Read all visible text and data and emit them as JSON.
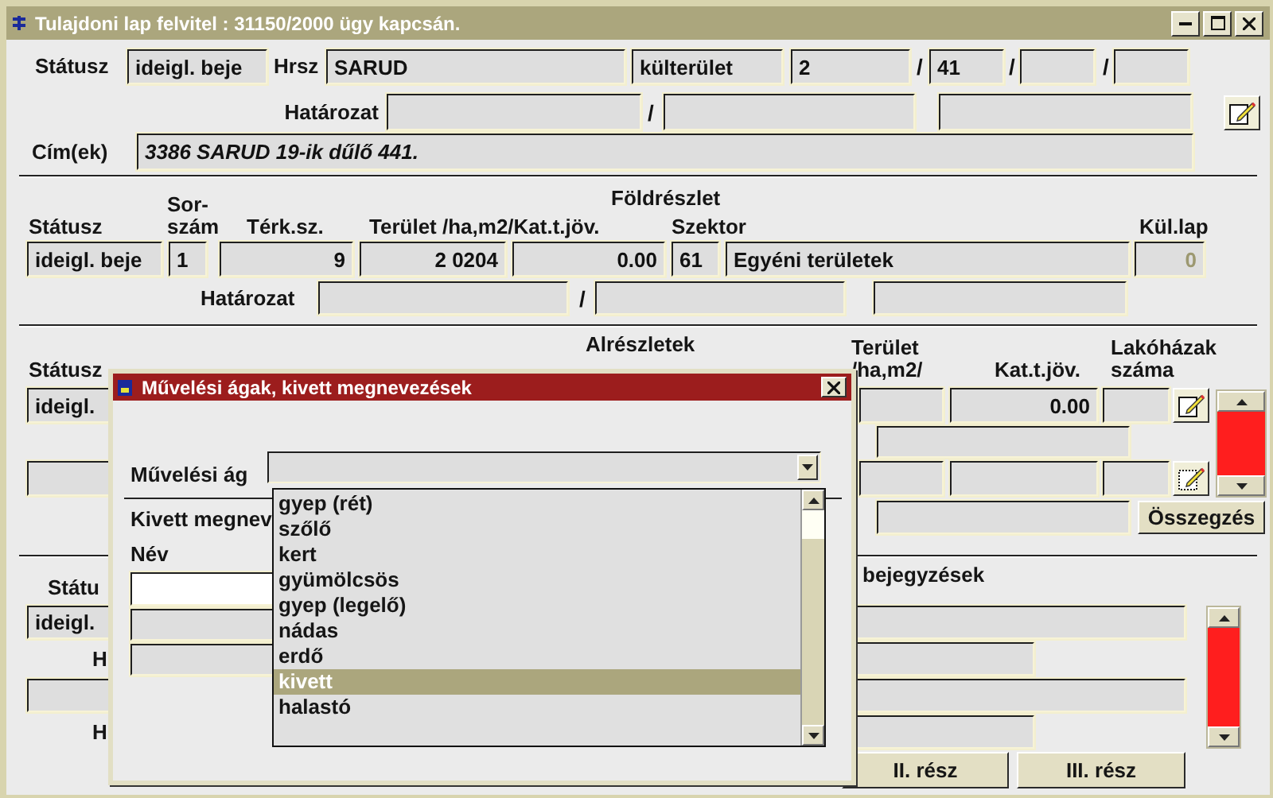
{
  "window": {
    "title": "Tulajdoni lap felvitel : 31150/2000 ügy kapcsán."
  },
  "main": {
    "status_label": "Státusz",
    "status": "ideigl. beje",
    "hrsz_label": "Hrsz",
    "settlement": "SARUD",
    "area_type": "külterület",
    "hrsz_parts": [
      "2",
      "41"
    ],
    "separators": [
      "/",
      "/",
      "/"
    ],
    "decision_label": "Határozat",
    "decision_separator": "/",
    "address_label": "Cím(ek)",
    "address": "3386 SARUD 19-ik dűlő 441."
  },
  "parcel": {
    "title": "Földrészlet",
    "columns": [
      "Státusz",
      "Sor-\nszám",
      "Térk.sz.",
      "Terület /ha,m2/Kat.t.jöv.",
      "Szektor",
      "Kül.lap"
    ],
    "status": "ideigl. beje",
    "serial": "1",
    "map_no": "9",
    "area": "2 0204",
    "value": "0.00",
    "sector_code": "61",
    "sector": "Egyéni területek",
    "extra_sheet": "0",
    "extra_sheet_disabled": true,
    "decision_label": "Határozat",
    "decision_separator": "/"
  },
  "subparcels": {
    "title": "Alrészletek",
    "status_label": "Státusz",
    "area_label": "Terület\n/ha,m2/",
    "value_label": "Kat.t.jöv.",
    "houses_label": "Lakóházak\nszáma",
    "status": "ideigl.",
    "value": "0.00",
    "sum_button": "Összegzés"
  },
  "entries": {
    "status_label": "Státu",
    "title": "bejegyzések",
    "status": "ideigl.",
    "labels": [
      "H",
      "H"
    ],
    "buttons": [
      "II. rész",
      "III. rész"
    ]
  },
  "dialog": {
    "title": "Művelési ágak, kivett megnevezések",
    "branch_label": "Művelési ág",
    "removed_label": "Kivett megnev",
    "name_label": "Név",
    "options": [
      {
        "label": "gyep (rét)",
        "selected": false
      },
      {
        "label": "szőlő",
        "selected": false
      },
      {
        "label": "kert",
        "selected": false
      },
      {
        "label": "gyümölcsös",
        "selected": false
      },
      {
        "label": "gyep (legelő)",
        "selected": false
      },
      {
        "label": "nádas",
        "selected": false
      },
      {
        "label": "erdő",
        "selected": false
      },
      {
        "label": "kivett",
        "selected": true
      },
      {
        "label": "halastó",
        "selected": false
      }
    ]
  }
}
